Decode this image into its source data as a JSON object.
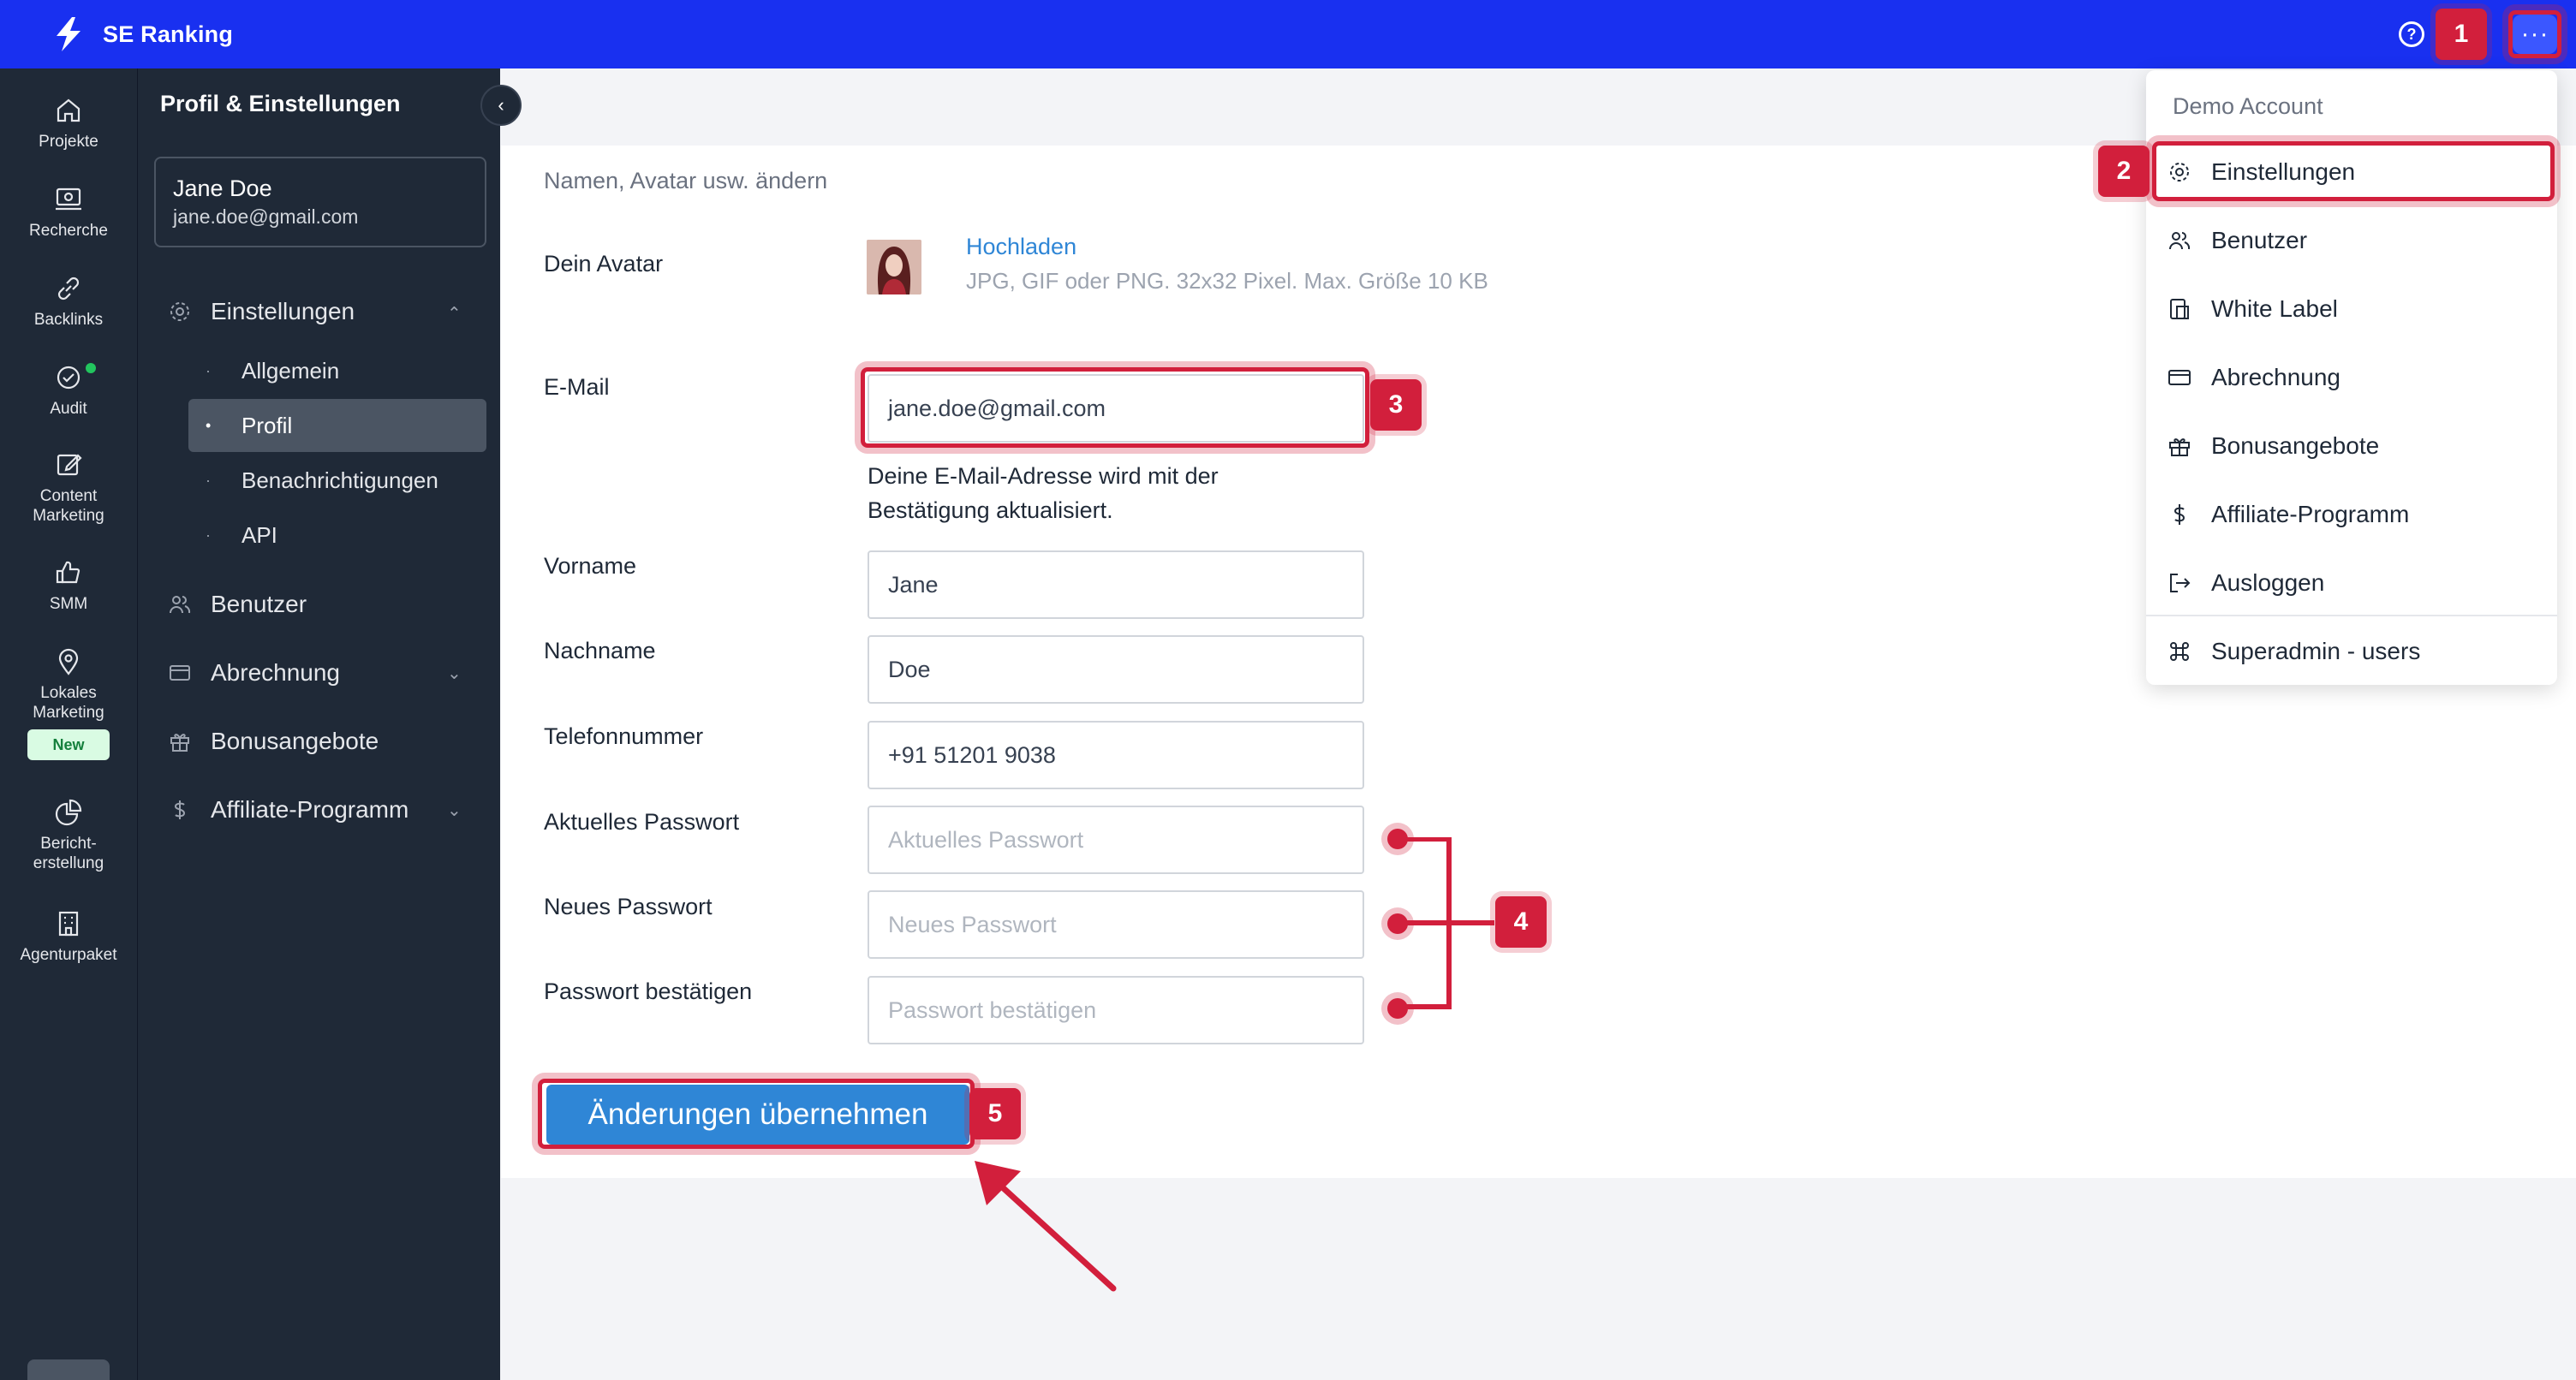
{
  "app": {
    "name": "SE Ranking"
  },
  "topbar": {
    "help_label": "?",
    "more_label": "···"
  },
  "rail": {
    "items": [
      {
        "label": "Projekte"
      },
      {
        "label": "Recherche"
      },
      {
        "label": "Backlinks"
      },
      {
        "label": "Audit"
      },
      {
        "label": "Content\nMarketing"
      },
      {
        "label": "SMM"
      },
      {
        "label": "Lokales\nMarketing"
      },
      {
        "label": "Bericht-\nerstellung"
      },
      {
        "label": "Agenturpaket"
      }
    ],
    "new_badge": "New"
  },
  "sidebar": {
    "title": "Profil & Einstellungen",
    "user": {
      "name": "Jane Doe",
      "email": "jane.doe@gmail.com"
    },
    "sections": [
      {
        "label": "Einstellungen"
      },
      {
        "label": "Benutzer"
      },
      {
        "label": "Abrechnung"
      },
      {
        "label": "Bonusangebote"
      },
      {
        "label": "Affiliate-Programm"
      }
    ],
    "sub_items": [
      {
        "label": "Allgemein"
      },
      {
        "label": "Profil"
      },
      {
        "label": "Benachrichtigungen"
      },
      {
        "label": "API"
      }
    ]
  },
  "main": {
    "subtitle": "Namen, Avatar usw. ändern",
    "avatar": {
      "label": "Dein Avatar",
      "upload": "Hochladen",
      "hint": "JPG, GIF oder PNG. 32x32 Pixel. Max. Größe 10 KB"
    },
    "email": {
      "label": "E-Mail",
      "value": "jane.doe@gmail.com",
      "note": "Deine E-Mail-Adresse wird mit der Bestätigung aktualisiert."
    },
    "first_name": {
      "label": "Vorname",
      "value": "Jane"
    },
    "last_name": {
      "label": "Nachname",
      "value": "Doe"
    },
    "phone": {
      "label": "Telefonnummer",
      "value": "+91 51201 9038"
    },
    "current_password": {
      "label": "Aktuelles Passwort",
      "placeholder": "Aktuelles Passwort"
    },
    "new_password": {
      "label": "Neues Passwort",
      "placeholder": "Neues Passwort"
    },
    "confirm_password": {
      "label": "Passwort bestätigen",
      "placeholder": "Passwort bestätigen"
    },
    "apply_button": "Änderungen übernehmen"
  },
  "dropdown": {
    "header": "Demo Account",
    "items": [
      {
        "label": "Einstellungen",
        "icon": "gear-icon"
      },
      {
        "label": "Benutzer",
        "icon": "users-icon"
      },
      {
        "label": "White Label",
        "icon": "white-label-icon"
      },
      {
        "label": "Abrechnung",
        "icon": "card-icon"
      },
      {
        "label": "Bonusangebote",
        "icon": "gift-icon"
      },
      {
        "label": "Affiliate-Programm",
        "icon": "dollar-icon"
      },
      {
        "label": "Ausloggen",
        "icon": "logout-icon"
      },
      {
        "label": "Superadmin - users",
        "icon": "command-icon"
      }
    ]
  },
  "annotations": {
    "n1": "1",
    "n2": "2",
    "n3": "3",
    "n4": "4",
    "n5": "5",
    "color": "#d21f3c"
  },
  "colors": {
    "topbar": "#1930f0",
    "sidebar": "#1f2937",
    "primary_button": "#2f86d6",
    "link": "#2f86d6"
  }
}
